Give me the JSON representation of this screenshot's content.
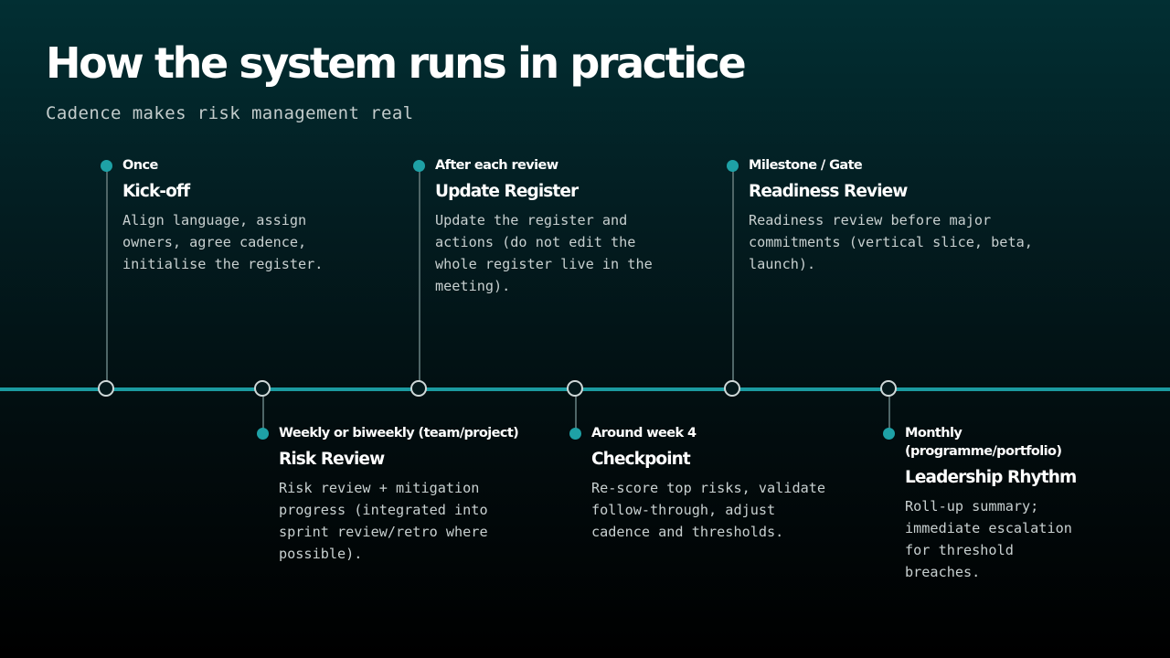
{
  "slide": {
    "title": "How the system runs in practice",
    "subtitle": "Cadence makes risk management real"
  },
  "colors": {
    "accent": "#1ea1a6",
    "timeline": "#1b9aa0",
    "connector": "#4f6667",
    "text": "#ffffff",
    "muted_text": "#c8d0d0"
  },
  "timeline": {
    "events": [
      {
        "frequency": "Once",
        "title": "Kick-off",
        "description": "Align language, assign\nowners, agree cadence,\ninitialise the register."
      },
      {
        "frequency": "Weekly or biweekly (team/project)",
        "title": "Risk Review",
        "description": "Risk review + mitigation\nprogress (integrated into\nsprint review/retro where\npossible)."
      },
      {
        "frequency": "After each review",
        "title": "Update Register",
        "description": "Update the register and\nactions (do not edit the\nwhole register live in the\nmeeting)."
      },
      {
        "frequency": "Around week 4",
        "title": "Checkpoint",
        "description": "Re-score top risks, validate\nfollow-through, adjust\ncadence and thresholds."
      },
      {
        "frequency": "Milestone / Gate",
        "title": "Readiness Review",
        "description": "Readiness review before major\ncommitments (vertical slice, beta,\nlaunch)."
      },
      {
        "frequency": "Monthly\n(programme/portfolio)",
        "title": "Leadership Rhythm",
        "description": "Roll-up summary;\nimmediate escalation\nfor threshold\nbreaches."
      }
    ]
  }
}
